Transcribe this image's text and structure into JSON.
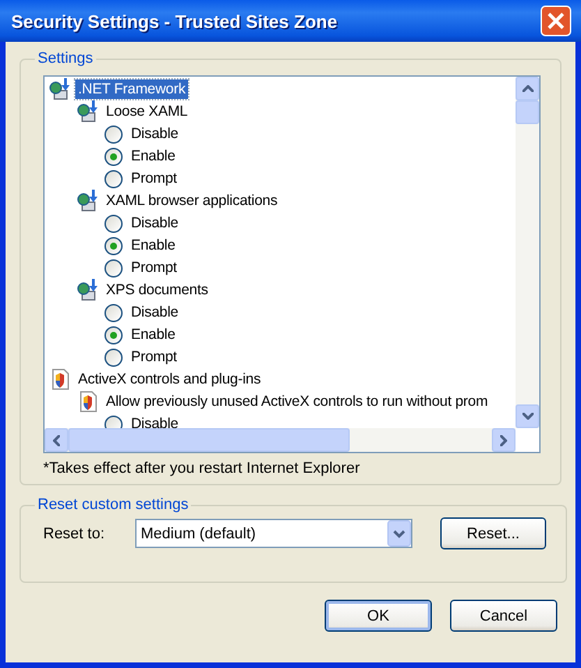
{
  "window": {
    "title": "Security Settings - Trusted Sites Zone"
  },
  "settings": {
    "legend": "Settings",
    "tree": [
      {
        "kind": "net",
        "label": ".NET Framework",
        "selected": true,
        "children": [
          {
            "kind": "net",
            "label": "Loose XAML",
            "selected": false,
            "children": [
              {
                "kind": "radio",
                "label": "Disable",
                "checked": false
              },
              {
                "kind": "radio",
                "label": "Enable",
                "checked": true
              },
              {
                "kind": "radio",
                "label": "Prompt",
                "checked": false
              }
            ]
          },
          {
            "kind": "net",
            "label": "XAML browser applications",
            "selected": false,
            "children": [
              {
                "kind": "radio",
                "label": "Disable",
                "checked": false
              },
              {
                "kind": "radio",
                "label": "Enable",
                "checked": true
              },
              {
                "kind": "radio",
                "label": "Prompt",
                "checked": false
              }
            ]
          },
          {
            "kind": "net",
            "label": "XPS documents",
            "selected": false,
            "children": [
              {
                "kind": "radio",
                "label": "Disable",
                "checked": false
              },
              {
                "kind": "radio",
                "label": "Enable",
                "checked": true
              },
              {
                "kind": "radio",
                "label": "Prompt",
                "checked": false
              }
            ]
          }
        ]
      },
      {
        "kind": "activex",
        "label": "ActiveX controls and plug-ins",
        "selected": false,
        "children": [
          {
            "kind": "activex",
            "label": "Allow previously unused ActiveX controls to run without prom",
            "selected": false,
            "children": [
              {
                "kind": "radio",
                "label": "Disable",
                "checked": false
              }
            ]
          }
        ]
      }
    ],
    "note": "*Takes effect after you restart Internet Explorer"
  },
  "reset": {
    "legend": "Reset custom settings",
    "label": "Reset to:",
    "value": "Medium (default)",
    "button": "Reset..."
  },
  "buttons": [
    "OK",
    "Cancel"
  ]
}
